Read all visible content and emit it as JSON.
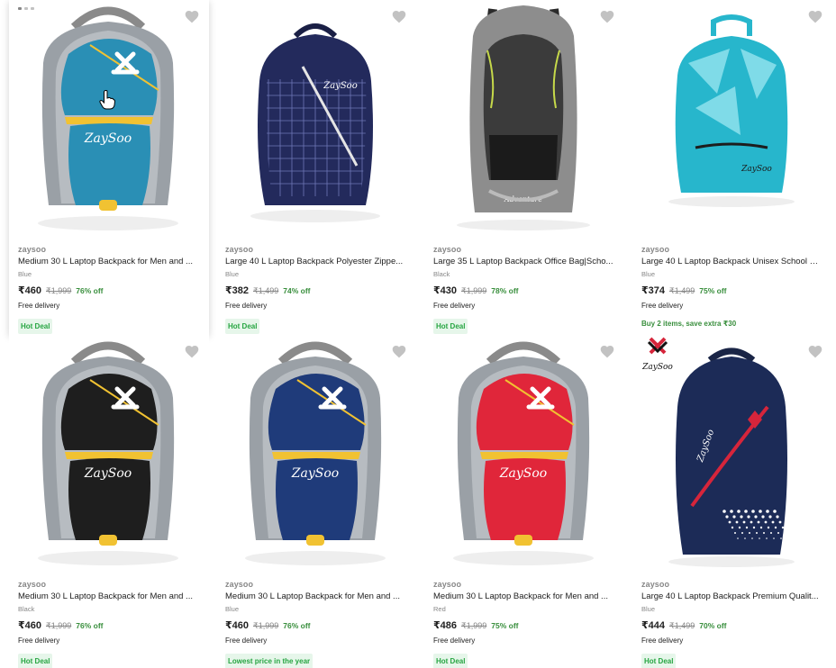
{
  "products": [
    {
      "brand": "zaysoo",
      "title": "Medium 30 L Laptop Backpack for Men and ...",
      "color": "Blue",
      "price": "₹460",
      "mrp": "₹1,999",
      "off": "76% off",
      "delivery": "Free delivery",
      "badge": "Hot Deal",
      "offer": "",
      "main": "#2a8fb5",
      "accent": "#9aa0a6",
      "zip": "#f1c232",
      "style": "zaysoo"
    },
    {
      "brand": "zaysoo",
      "title": "Large 40 L Laptop Backpack Polyester Zippe...",
      "color": "Blue",
      "price": "₹382",
      "mrp": "₹1,499",
      "off": "74% off",
      "delivery": "Free delivery",
      "badge": "Hot Deal",
      "offer": "",
      "main": "#232a5c",
      "accent": "#2e356b",
      "zip": "#1a1f45",
      "style": "grid"
    },
    {
      "brand": "zaysoo",
      "title": "Large 35 L Laptop Backpack Office Bag|Scho...",
      "color": "Black",
      "price": "₹430",
      "mrp": "₹1,999",
      "off": "78% off",
      "delivery": "Free delivery",
      "badge": "Hot Deal",
      "offer": "",
      "main": "#3b3b3b",
      "accent": "#8d8d8d",
      "zip": "#c6d94a",
      "style": "hiker"
    },
    {
      "brand": "zaysoo",
      "title": "Large 40 L Laptop Backpack Unisex School B...",
      "color": "Blue",
      "price": "₹374",
      "mrp": "₹1,499",
      "off": "75% off",
      "delivery": "Free delivery",
      "badge": "",
      "offer": "Buy 2 items, save extra ₹30",
      "main": "#27b6cc",
      "accent": "#7fdbe8",
      "zip": "#1d1d1d",
      "style": "geo"
    },
    {
      "brand": "zaysoo",
      "title": "Medium 30 L Laptop Backpack for Men and ...",
      "color": "Black",
      "price": "₹460",
      "mrp": "₹1,999",
      "off": "76% off",
      "delivery": "Free delivery",
      "badge": "Hot Deal",
      "offer": "",
      "main": "#1e1e1e",
      "accent": "#9aa0a6",
      "zip": "#f1c232",
      "style": "zaysoo"
    },
    {
      "brand": "zaysoo",
      "title": "Medium 30 L Laptop Backpack for Men and ...",
      "color": "Blue",
      "price": "₹460",
      "mrp": "₹1,999",
      "off": "76% off",
      "delivery": "Free delivery",
      "badge": "Lowest price in the year",
      "offer": "",
      "main": "#1f3b7a",
      "accent": "#9aa0a6",
      "zip": "#f1c232",
      "style": "zaysoo"
    },
    {
      "brand": "zaysoo",
      "title": "Medium 30 L Laptop Backpack for Men and ...",
      "color": "Red",
      "price": "₹486",
      "mrp": "₹1,999",
      "off": "75% off",
      "delivery": "Free delivery",
      "badge": "Hot Deal",
      "offer": "",
      "main": "#e0263a",
      "accent": "#9aa0a6",
      "zip": "#f1c232",
      "style": "zaysoo"
    },
    {
      "brand": "zaysoo",
      "title": "Large 40 L Laptop Backpack Premium Qualit...",
      "color": "Blue",
      "price": "₹444",
      "mrp": "₹1,499",
      "off": "70% off",
      "delivery": "Free delivery",
      "badge": "Hot Deal",
      "offer": "",
      "main": "#1c2b57",
      "accent": "#d6253b",
      "zip": "#ffffff",
      "style": "premium"
    }
  ],
  "logo_text": "ZaySoo",
  "bag_brand_text": "ZaySoo",
  "colors": {
    "wishlist": "#c2c2c2",
    "discount": "#388e3c",
    "badge_bg": "#e6f6ea",
    "badge_text": "#26a541"
  },
  "icons": {
    "wishlist": "heart-icon",
    "cursor": "hand-pointer-icon"
  }
}
